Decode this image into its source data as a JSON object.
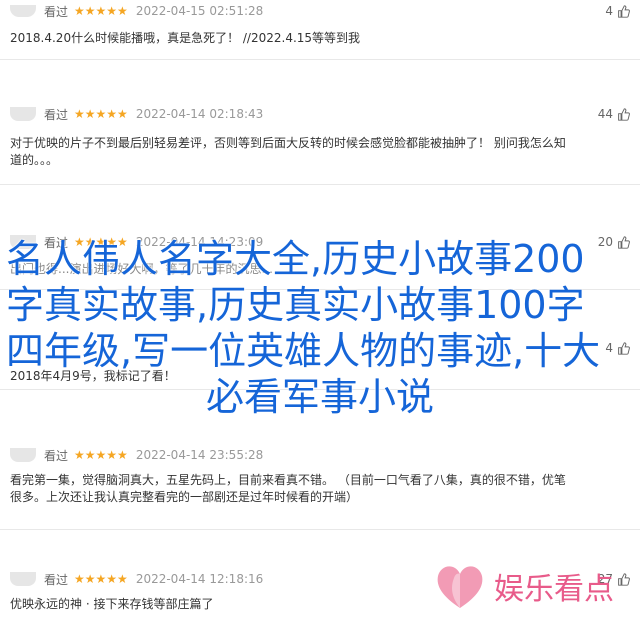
{
  "reviews": [
    {
      "status": "看过",
      "stars": "★★★★★",
      "time": "2022-04-15 02:51:28",
      "votes": "4",
      "lines": [
        "2018.4.20什么时候能播哦，真是急死了！ //2022.4.15等等到我"
      ]
    },
    {
      "status": "看过",
      "stars": "★★★★★",
      "time": "2022-04-14 02:18:43",
      "votes": "44",
      "lines": [
        "对于优映的片子不到最后别轻易差评，否则等到后面大反转的时候会感觉脸都能被抽肿了！ 别问我怎么知",
        "道的。。。"
      ]
    },
    {
      "status": "看过",
      "stars": "★★★★★",
      "time": "2022-04-14 14:23:09",
      "votes": "20",
      "lines": [
        "出门也得...演出进场好大啊，等了几十年的沉思..."
      ]
    },
    {
      "status": "",
      "stars": "",
      "time": "",
      "votes": "",
      "lines": [
        "2018年4月9号，我标记了看！"
      ]
    },
    {
      "status": "看过",
      "stars": "★★★★★",
      "time": "2022-04-14 23:55:28",
      "votes": "",
      "lines": [
        "看完第一集，觉得脑洞真大，五星先码上，目前来看真不错。 （目前一口气看了八集，真的很不错，优笔",
        "很多。上次还让我认真完整看完的一部剧还是过年时候看的开端）"
      ]
    },
    {
      "status": "看过",
      "stars": "★★★★★",
      "time": "2022-04-14 12:18:16",
      "votes": "27",
      "lines": [
        "优映永远的神 · 接下来存钱等部庄篇了"
      ]
    }
  ],
  "overlay_title": [
    "名人伟人名字大全,历史小故事200",
    "字真实故事,历史真实小故事100字",
    "四年级,写一位英雄人物的事迹,十大",
    "必看军事小说"
  ],
  "partial_votes": {
    "row4": "4"
  },
  "logo_text": "娱乐看点",
  "colors": {
    "star": "#f5a623",
    "title": "#1565d8",
    "logo": "#e85b8a"
  }
}
